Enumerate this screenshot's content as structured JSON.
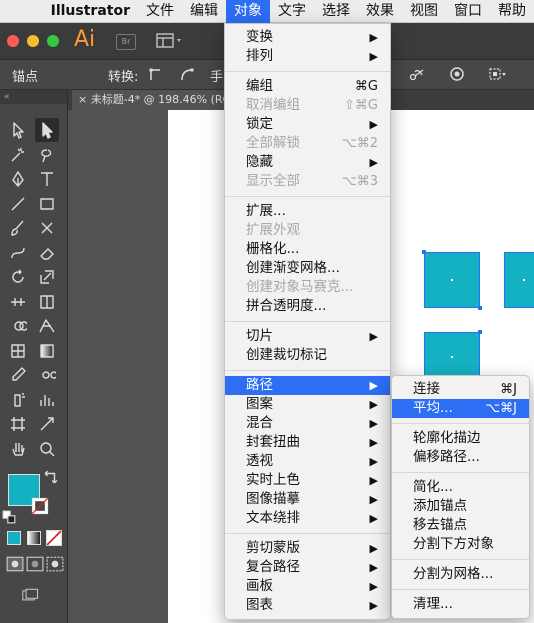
{
  "menubar": {
    "items": [
      {
        "label": "Illustrator"
      },
      {
        "label": "文件"
      },
      {
        "label": "编辑"
      },
      {
        "label": "对象"
      },
      {
        "label": "文字"
      },
      {
        "label": "选择"
      },
      {
        "label": "效果"
      },
      {
        "label": "视图"
      },
      {
        "label": "窗口"
      },
      {
        "label": "帮助"
      }
    ]
  },
  "appbar": {
    "logo": "Ai",
    "bridge_label": "Br"
  },
  "controlbar": {
    "selection_label": "锚点",
    "convert_label": "转换:",
    "hand_label": "手"
  },
  "document": {
    "tab_title": "未标题-4* @ 198.46% (RGB"
  },
  "colors": {
    "accent": "#2d6ef5",
    "fill": "#14b1c2",
    "menu_bg": "#f2f2f2"
  },
  "object_menu": {
    "g1": [
      {
        "label": "变换",
        "submenu": true
      },
      {
        "label": "排列",
        "submenu": true
      }
    ],
    "g2": [
      {
        "label": "编组",
        "shortcut": "⌘G"
      },
      {
        "label": "取消编组",
        "shortcut": "⇧⌘G",
        "disabled": true
      },
      {
        "label": "锁定",
        "submenu": true
      },
      {
        "label": "全部解锁",
        "shortcut": "⌥⌘2",
        "disabled": true
      },
      {
        "label": "隐藏",
        "submenu": true
      },
      {
        "label": "显示全部",
        "shortcut": "⌥⌘3",
        "disabled": true
      }
    ],
    "g3": [
      {
        "label": "扩展..."
      },
      {
        "label": "扩展外观",
        "disabled": true
      },
      {
        "label": "栅格化..."
      },
      {
        "label": "创建渐变网格..."
      },
      {
        "label": "创建对象马赛克...",
        "disabled": true
      },
      {
        "label": "拼合透明度..."
      }
    ],
    "g4": [
      {
        "label": "切片",
        "submenu": true
      },
      {
        "label": "创建裁切标记"
      }
    ],
    "g5": [
      {
        "label": "路径",
        "submenu": true,
        "highlighted": true
      },
      {
        "label": "图案",
        "submenu": true
      },
      {
        "label": "混合",
        "submenu": true
      },
      {
        "label": "封套扭曲",
        "submenu": true
      },
      {
        "label": "透视",
        "submenu": true
      },
      {
        "label": "实时上色",
        "submenu": true
      },
      {
        "label": "图像描摹",
        "submenu": true
      },
      {
        "label": "文本绕排",
        "submenu": true
      }
    ],
    "g6": [
      {
        "label": "剪切蒙版",
        "submenu": true
      },
      {
        "label": "复合路径",
        "submenu": true
      },
      {
        "label": "画板",
        "submenu": true
      },
      {
        "label": "图表",
        "submenu": true
      }
    ]
  },
  "path_menu": {
    "g1": [
      {
        "label": "连接",
        "shortcut": "⌘J"
      },
      {
        "label": "平均...",
        "shortcut": "⌥⌘J",
        "highlighted": true
      }
    ],
    "g2": [
      {
        "label": "轮廓化描边"
      },
      {
        "label": "偏移路径..."
      }
    ],
    "g3": [
      {
        "label": "简化..."
      },
      {
        "label": "添加锚点"
      },
      {
        "label": "移去锚点"
      },
      {
        "label": "分割下方对象"
      }
    ],
    "g4": [
      {
        "label": "分割为网格..."
      }
    ],
    "g5": [
      {
        "label": "清理..."
      }
    ]
  },
  "arrow_glyph": "▶"
}
